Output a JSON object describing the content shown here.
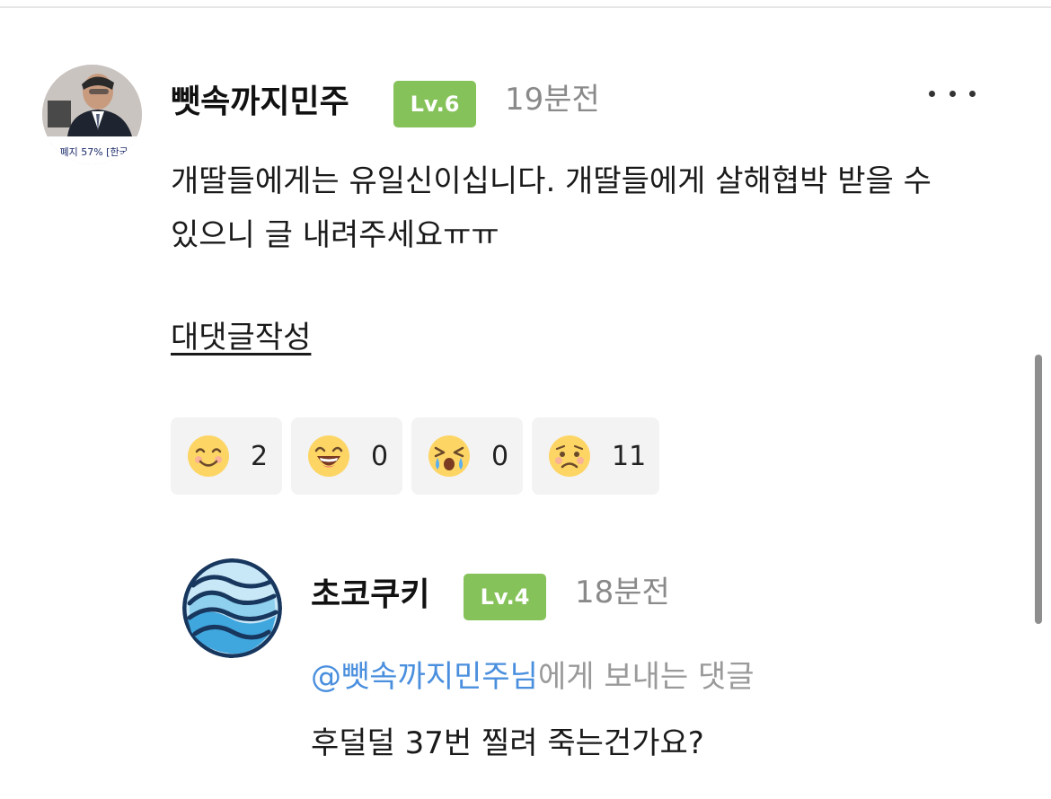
{
  "main_comment": {
    "username": "뺏속까지민주",
    "level": "Lv.6",
    "time": "19분전",
    "body": "개딸들에게는 유일신이십니다. 개딸들에게 살해협박 받을 수 있으니 글 내려주세요ㅠㅠ",
    "avatar_caption": "·폐지 57% [한국",
    "reply_action": "대댓글작성",
    "reactions": [
      {
        "icon": "smile-face-icon",
        "count": "2"
      },
      {
        "icon": "laughing-face-icon",
        "count": "0"
      },
      {
        "icon": "crying-face-icon",
        "count": "0"
      },
      {
        "icon": "sad-face-icon",
        "count": "11"
      }
    ]
  },
  "reply": {
    "username": "초코쿠키",
    "level": "Lv.4",
    "time": "18분전",
    "mention": "@뺏속까지민주님",
    "mention_suffix": "에게 보내는 댓글",
    "body": "후덜덜 37번 찔려 죽는건가요?"
  },
  "colors": {
    "level_badge": "#86c25a",
    "mention": "#4a8fde",
    "muted_text": "#8a8a8a"
  }
}
